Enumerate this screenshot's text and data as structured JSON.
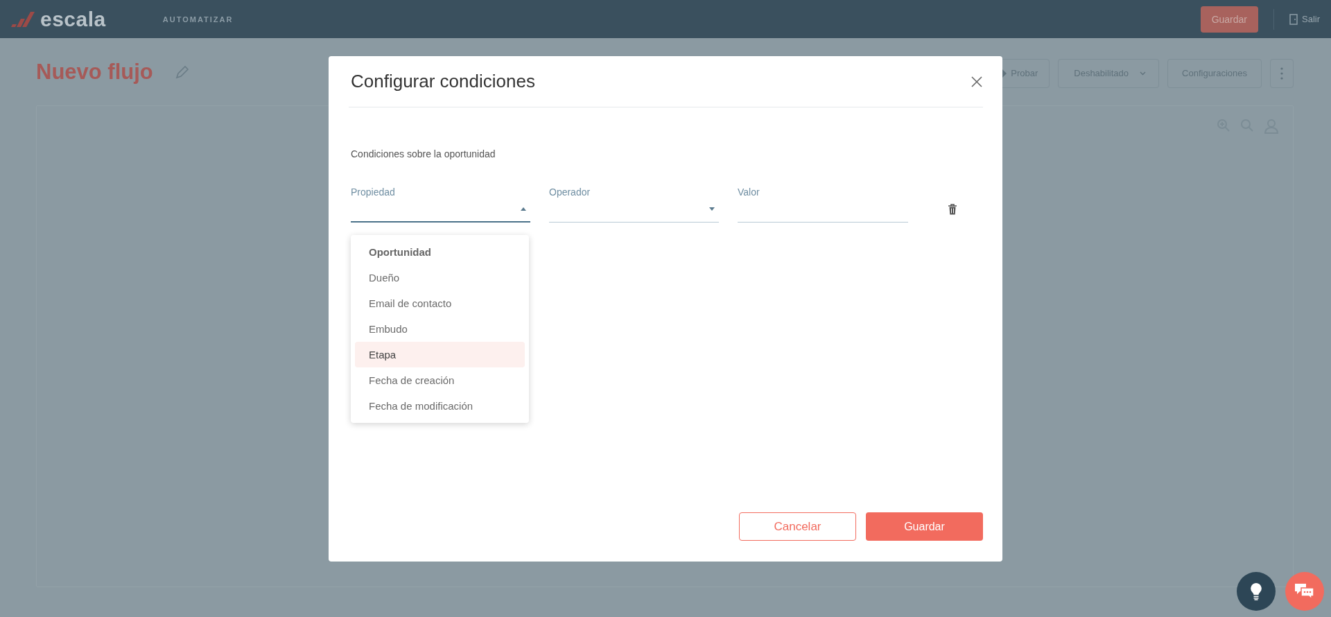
{
  "app_bar": {
    "logo": "escala",
    "nav_item": "AUTOMATIZAR",
    "save_button": "Guardar",
    "exit_link": "Salir"
  },
  "page": {
    "title": "Nuevo flujo",
    "toolbar": [
      {
        "kind": "icon_button",
        "label": "Probar"
      },
      {
        "kind": "dropdown",
        "label": "Deshabilitado"
      },
      {
        "kind": "button",
        "label": "Configuraciones"
      },
      {
        "kind": "more"
      }
    ]
  },
  "dialog": {
    "title": "Configurar condiciones",
    "section_label": "Condiciones sobre la oportunidad",
    "fields": [
      {
        "label": "Propiedad",
        "kind": "select",
        "expanded": true
      },
      {
        "label": "Operador",
        "kind": "select",
        "expanded": false
      },
      {
        "label": "Valor",
        "kind": "text"
      }
    ],
    "menu": [
      {
        "kind": "header",
        "label": "Oportunidad"
      },
      {
        "kind": "option",
        "label": "Dueño",
        "selected": false
      },
      {
        "kind": "option",
        "label": "Email de contacto",
        "selected": false
      },
      {
        "kind": "option",
        "label": "Embudo",
        "selected": false
      },
      {
        "kind": "option",
        "label": "Etapa",
        "selected": true
      },
      {
        "kind": "option",
        "label": "Fecha de creación",
        "selected": false
      },
      {
        "kind": "option",
        "label": "Fecha de modificación",
        "selected": false
      }
    ],
    "buttons": [
      {
        "kind": "secondary",
        "label": "Cancelar"
      },
      {
        "kind": "primary",
        "label": "Guardar"
      }
    ]
  }
}
